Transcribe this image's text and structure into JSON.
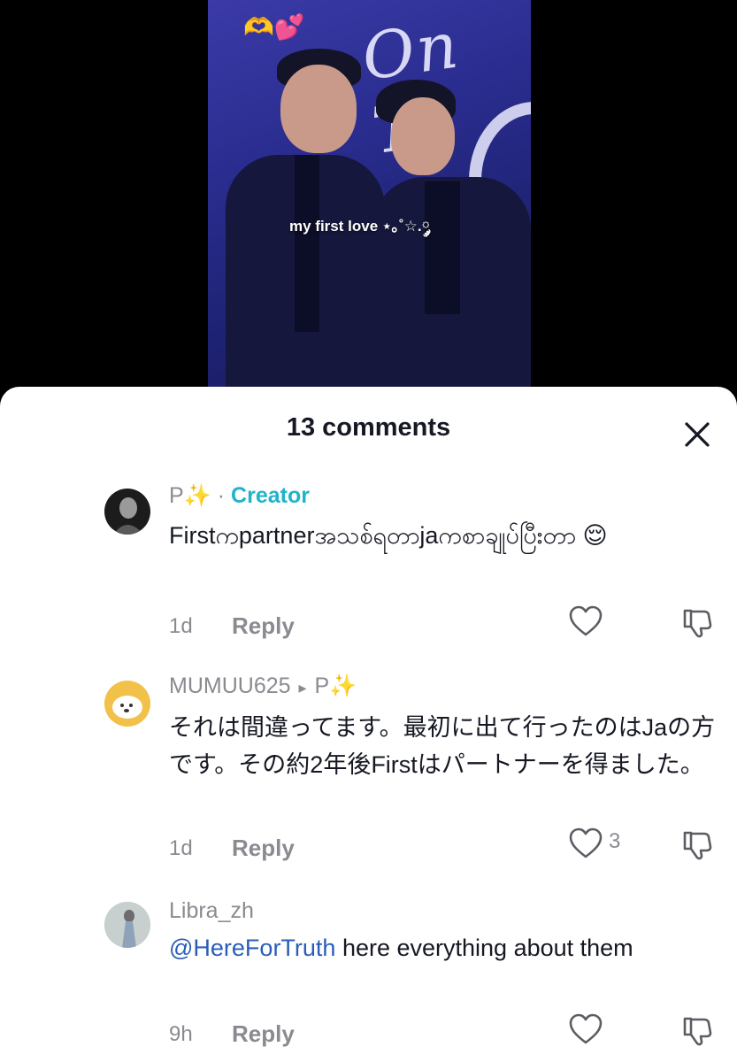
{
  "video": {
    "caption": "my first love ⋆｡˚☆.༘",
    "overlay_emoji": "🫶💕",
    "stage_text": "On Th"
  },
  "sheet": {
    "title": "13 comments",
    "close_icon": "close-icon"
  },
  "comments": [
    {
      "user": "P✨",
      "separator": " · ",
      "badge": "Creator",
      "text": "Firstကpartnerအသစ်ရတာjaကစာချုပ်ပြီးတာ 😌",
      "time": "1d",
      "reply": "Reply",
      "likes": ""
    },
    {
      "user": "MUMUU625",
      "reply_arrow": "▸",
      "reply_to": "P✨",
      "text": "それは間違ってます。最初に出て行ったのはJaの方です。その約2年後Firstはパートナーを得ました。",
      "time": "1d",
      "reply": "Reply",
      "likes": "3"
    },
    {
      "user": "Libra_zh",
      "mention": "@HereForTruth",
      "text": " here everything about them",
      "time": "9h",
      "reply": "Reply",
      "likes": ""
    }
  ],
  "colors": {
    "creator": "#20b4c8",
    "mention": "#2b5db8",
    "muted": "#8a8b91",
    "text": "#161823"
  }
}
